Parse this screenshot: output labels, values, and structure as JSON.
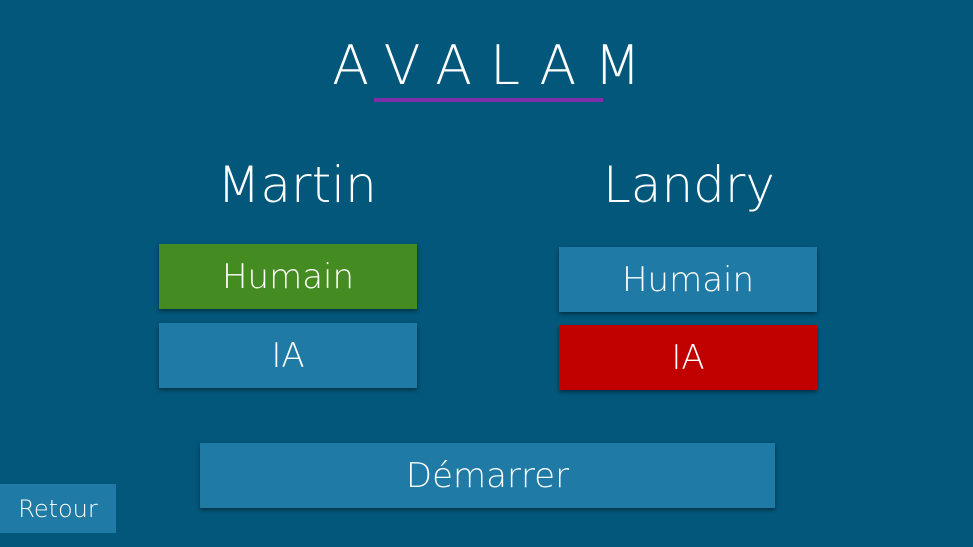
{
  "app": {
    "title": "AVALAM"
  },
  "players": [
    {
      "name": "Martin",
      "options": [
        {
          "label": "Humain",
          "selected": true
        },
        {
          "label": "IA",
          "selected": false
        }
      ]
    },
    {
      "name": "Landry",
      "options": [
        {
          "label": "Humain",
          "selected": false
        },
        {
          "label": "IA",
          "selected": true
        }
      ]
    }
  ],
  "actions": {
    "start_label": "Démarrer",
    "back_label": "Retour"
  },
  "colors": {
    "background": "#03577a",
    "button_default": "#1f7aa5",
    "human_selected": "#448c22",
    "ai_selected": "#c10000",
    "title_underline": "#7b2fa8"
  }
}
